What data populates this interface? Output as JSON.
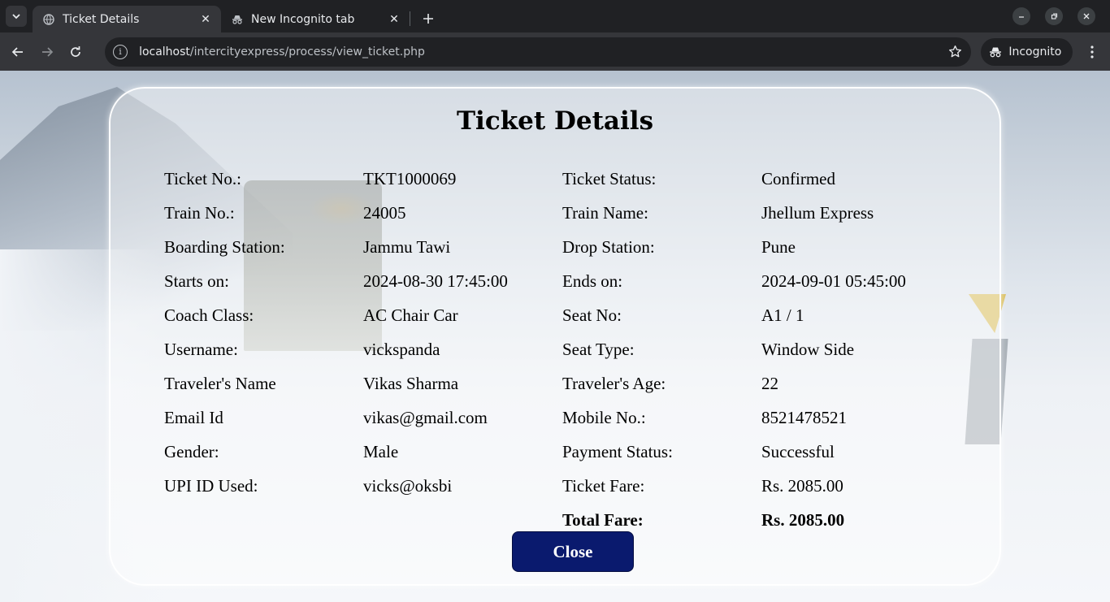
{
  "browser": {
    "tabs": [
      {
        "title": "Ticket Details",
        "active": true
      },
      {
        "title": "New Incognito tab",
        "active": false
      }
    ],
    "url_host": "localhost",
    "url_path": "/intercityexpress/process/view_ticket.php",
    "incognito_label": "Incognito"
  },
  "page": {
    "title": "Ticket Details",
    "rows": [
      {
        "l1": "Ticket No.:",
        "v1": "TKT1000069",
        "l2": "Ticket Status:",
        "v2": "Confirmed"
      },
      {
        "l1": "Train No.:",
        "v1": "24005",
        "l2": "Train Name:",
        "v2": "Jhellum Express"
      },
      {
        "l1": "Boarding Station:",
        "v1": "Jammu Tawi",
        "l2": "Drop Station:",
        "v2": "Pune"
      },
      {
        "l1": "Starts on:",
        "v1": "2024-08-30 17:45:00",
        "l2": "Ends on:",
        "v2": "2024-09-01 05:45:00"
      },
      {
        "l1": "Coach Class:",
        "v1": "AC Chair Car",
        "l2": "Seat No:",
        "v2": "A1 / 1"
      },
      {
        "l1": "Username:",
        "v1": "vickspanda",
        "l2": "Seat Type:",
        "v2": "Window Side"
      },
      {
        "l1": "Traveler's Name",
        "v1": "Vikas Sharma",
        "l2": "Traveler's Age:",
        "v2": "22"
      },
      {
        "l1": "Email Id",
        "v1": "vikas@gmail.com",
        "l2": "Mobile No.:",
        "v2": "8521478521"
      },
      {
        "l1": "Gender:",
        "v1": "Male",
        "l2": "Payment Status:",
        "v2": "Successful"
      },
      {
        "l1": "UPI ID Used:",
        "v1": "vicks@oksbi",
        "l2": "Ticket Fare:",
        "v2": "Rs. 2085.00"
      }
    ],
    "total_label": "Total Fare:",
    "total_value": "Rs. 2085.00",
    "close_label": "Close"
  },
  "colors": {
    "close_button": "#0a1a6e",
    "chrome_dark": "#202124",
    "chrome_toolbar": "#35363a"
  }
}
